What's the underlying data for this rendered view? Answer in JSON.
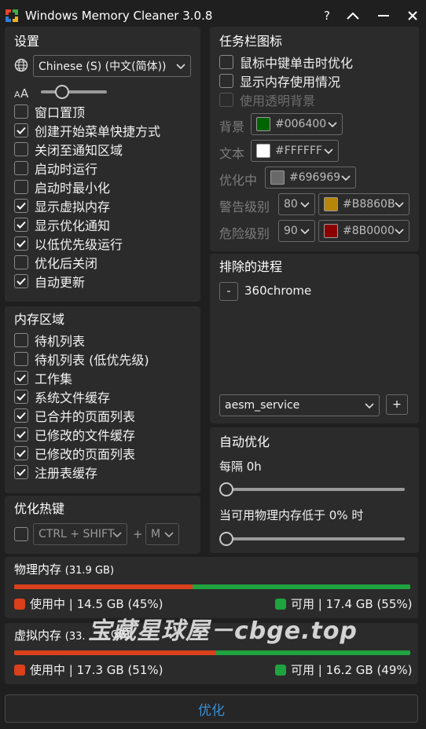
{
  "titlebar": {
    "title": "Windows Memory Cleaner 3.0.8",
    "help": "?",
    "collapse_icon": "chevron-up-icon",
    "minimize": "—",
    "close": "✕"
  },
  "settings": {
    "title": "设置",
    "language": "Chinese (S) (中文(简体))",
    "checkboxes": [
      {
        "label": "窗口置顶",
        "checked": false
      },
      {
        "label": "创建开始菜单快捷方式",
        "checked": true
      },
      {
        "label": "关闭至通知区域",
        "checked": false
      },
      {
        "label": "启动时运行",
        "checked": false
      },
      {
        "label": "启动时最小化",
        "checked": false
      },
      {
        "label": "显示虚拟内存",
        "checked": true
      },
      {
        "label": "显示优化通知",
        "checked": true
      },
      {
        "label": "以低优先级运行",
        "checked": true
      },
      {
        "label": "优化后关闭",
        "checked": false
      },
      {
        "label": "自动更新",
        "checked": true
      }
    ]
  },
  "memory_areas": {
    "title": "内存区域",
    "checkboxes": [
      {
        "label": "待机列表",
        "checked": false
      },
      {
        "label": "待机列表 (低优先级)",
        "checked": false
      },
      {
        "label": "工作集",
        "checked": true
      },
      {
        "label": "系统文件缓存",
        "checked": true
      },
      {
        "label": "已合并的页面列表",
        "checked": true
      },
      {
        "label": "已修改的文件缓存",
        "checked": true
      },
      {
        "label": "已修改的页面列表",
        "checked": true
      },
      {
        "label": "注册表缓存",
        "checked": true
      }
    ]
  },
  "hotkey": {
    "title": "优化热键",
    "modifier": "CTRL + SHIFT",
    "plus": "+",
    "key": "M"
  },
  "tray": {
    "title": "任务栏图标",
    "checkboxes": [
      {
        "label": "鼠标中键单击时优化",
        "checked": false
      },
      {
        "label": "显示内存使用情况",
        "checked": false
      },
      {
        "label": "使用透明背景",
        "checked": false,
        "disabled": true
      }
    ],
    "background_label": "背景",
    "background_color": "#006400",
    "background_text": "#006400",
    "text_label": "文本",
    "text_color": "#FFFFFF",
    "text_text": "#FFFFFF",
    "optimizing_label": "优化中",
    "optimizing_color": "#696969",
    "optimizing_text": "#696969",
    "warning_label": "警告级别",
    "warning_level": "80",
    "warning_color": "#B8860B",
    "warning_text": "#B8860B",
    "danger_label": "危险级别",
    "danger_level": "90",
    "danger_color": "#8B0000",
    "danger_text": "#8B0000"
  },
  "excluded": {
    "title": "排除的进程",
    "remove_label": "-",
    "items": [
      "360chrome"
    ],
    "select_value": "aesm_service",
    "add_label": "+"
  },
  "auto_optimize": {
    "title": "自动优化",
    "interval_label": "每隔 0h",
    "interval_value": 0,
    "threshold_label": "当可用物理内存低于 0% 时",
    "threshold_value": 0
  },
  "physical": {
    "title": "物理内存",
    "total": "(31.9 GB)",
    "used_percent": 45,
    "used_label": "使用中 | 14.5 GB (45%)",
    "free_label": "可用 | 17.4 GB (55%)"
  },
  "virtual": {
    "title": "虚拟内存",
    "total": "(33.",
    "total_tail": "GB)",
    "used_percent": 51,
    "used_label": "使用中 | 17.3 GB (51%)",
    "free_label": "可用 | 16.2 GB (49%)"
  },
  "optimize_button": "优化",
  "watermark": "宝藏星球屋－cbge.top",
  "colors": {
    "used": "#d9401b",
    "free": "#1fa33f",
    "accent": "#3a8fd8"
  }
}
